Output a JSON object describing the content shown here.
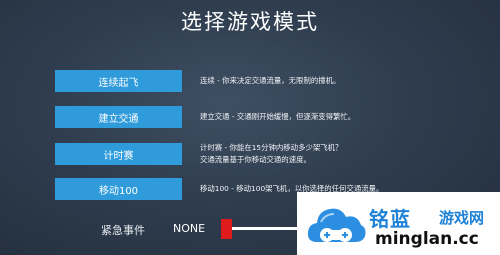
{
  "title": "选择游戏模式",
  "modes": [
    {
      "label": "连续起飞",
      "desc": [
        "连续 - 你来决定交通流量，无限制的撞机。"
      ]
    },
    {
      "label": "建立交通",
      "desc": [
        "建立交通 - 交通刚开始缓慢，但逐渐变得繁忙。"
      ]
    },
    {
      "label": "计时赛",
      "desc": [
        "计时赛 - 你能在15分钟内移动多少架飞机？",
        "交通流量基于你移动交通的速度。"
      ]
    },
    {
      "label": "移动100",
      "desc": [
        "移动100 - 移动100架飞机，以你选择的任何交通流量。"
      ]
    }
  ],
  "emergency": {
    "label": "紧急事件",
    "value": "NONE",
    "knob_color": "#e01b1b"
  },
  "watermark": {
    "brand": "铭蓝",
    "site": "游戏网",
    "domain": "minglan.cc"
  },
  "colors": {
    "button": "#2f9bdb",
    "watermark_blue": "#1f82d6"
  }
}
